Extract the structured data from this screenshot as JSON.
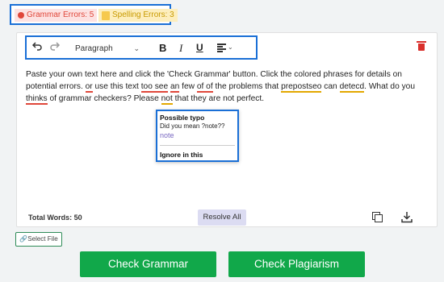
{
  "error_counts": {
    "grammar_label": "Grammar Errors: 5",
    "spelling_label": "Spelling Errors: 3"
  },
  "toolbar": {
    "undo_icon": "undo-icon",
    "redo_icon": "redo-icon",
    "paragraph_select": "Paragraph",
    "bold": "B",
    "italic": "I",
    "underline": "U",
    "align_icon": "align-left-icon",
    "delete_icon": "trash-icon"
  },
  "editor": {
    "segments": [
      "Paste your own text here and click the 'Check Grammar' button. Click the colored phrases for details on potential errors. ",
      "or",
      " use this text ",
      "too see",
      " ",
      "an",
      " few ",
      "of of",
      " the problems that ",
      "prepostseo",
      " can ",
      "detecd",
      ". What do you ",
      "thinks",
      " of grammar checkers? Please ",
      "not",
      " that they are not perfect."
    ],
    "popup": {
      "title": "Possible typo",
      "message": "Did you mean ?note??",
      "suggestion": "note",
      "ignore": "Ignore in this"
    },
    "total_words": "Total Words: 50",
    "resolve_all": "Resolve All",
    "copy_icon": "copy-icon",
    "download_icon": "download-icon"
  },
  "select_file": "Select File",
  "buttons": {
    "check_grammar": "Check Grammar",
    "check_plagiarism": "Check Plagiarism"
  },
  "colors": {
    "accent_blue": "#1a6fd6",
    "green": "#11a84a",
    "error_red": "#e0473a",
    "error_yellow": "#e3a800",
    "suggestion_purple": "#7a69c2"
  }
}
